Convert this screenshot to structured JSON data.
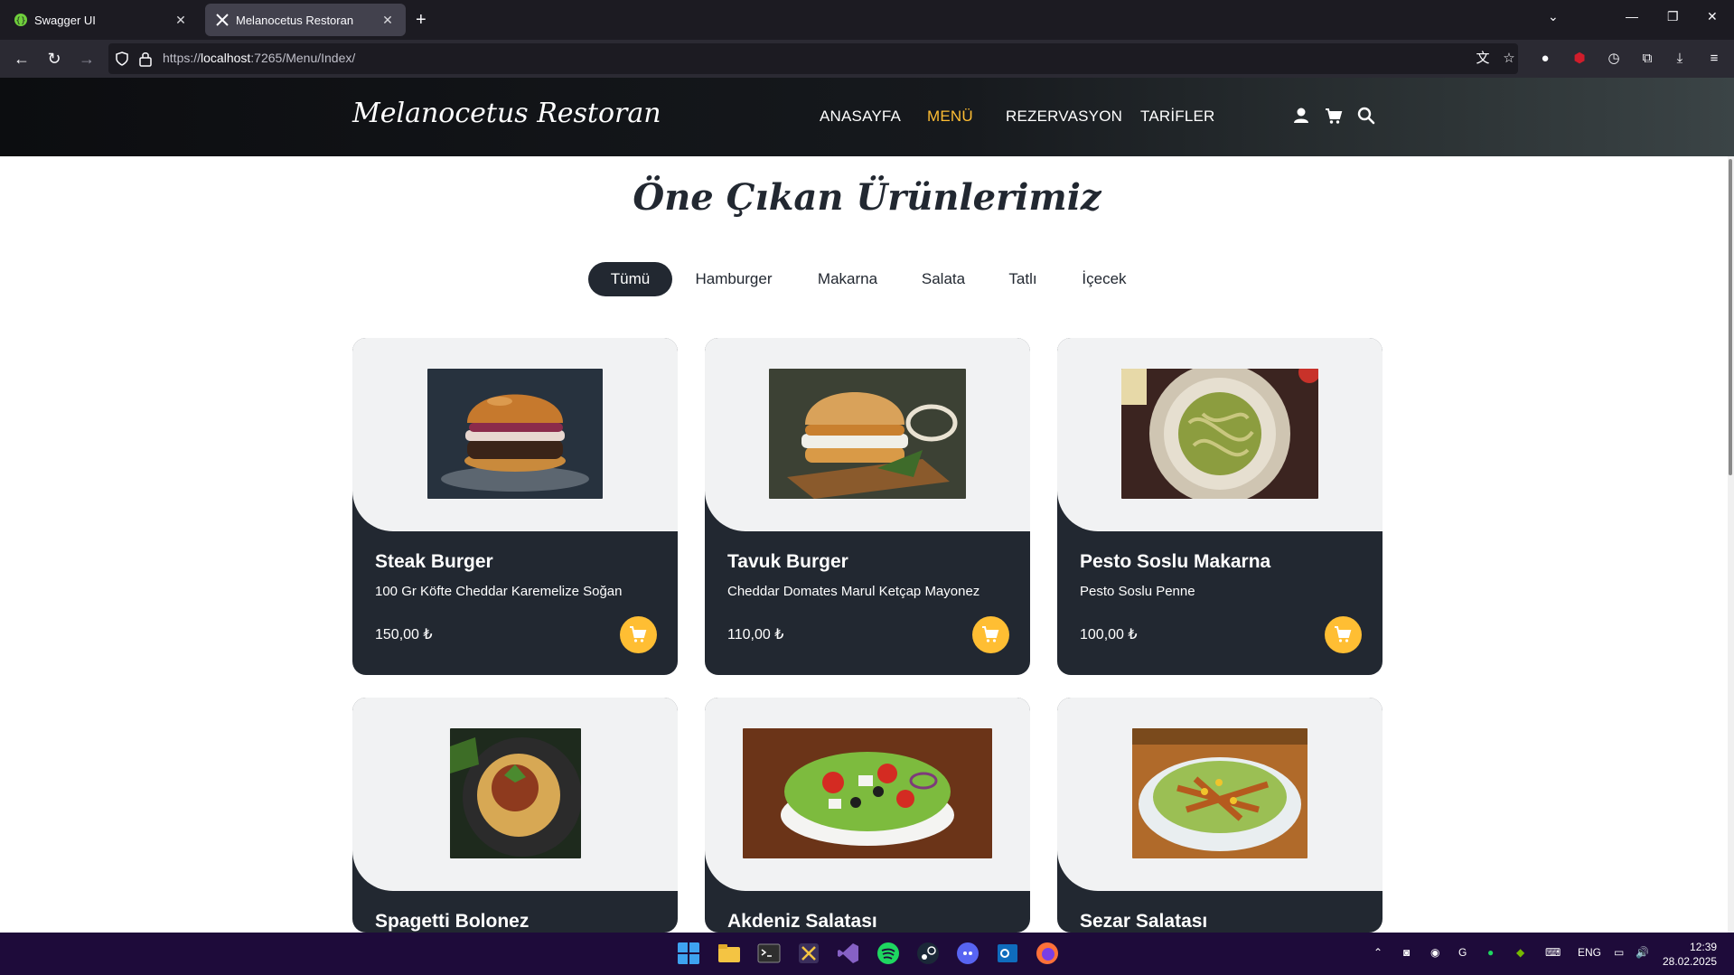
{
  "browser": {
    "tabs": [
      {
        "title": "Swagger UI",
        "favicon": "swagger-icon",
        "active": false
      },
      {
        "title": "Melanocetus Restoran",
        "favicon": "utensils-icon",
        "active": true
      }
    ],
    "url_prefix": "https://",
    "url_host": "localhost",
    "url_rest": ":7265/Menu/Index/"
  },
  "site": {
    "logo": "Melanocetus Restoran",
    "nav": [
      {
        "label": "ANASAYFA",
        "active": false
      },
      {
        "label": "MENÜ",
        "active": true
      },
      {
        "label": "REZERVASYON",
        "active": false
      },
      {
        "label": "TARİFLER",
        "active": false
      }
    ],
    "accent_color": "#ffbe33",
    "dark_color": "#222831"
  },
  "section": {
    "title": "Öne Çıkan Ürünlerimiz"
  },
  "filters": [
    "Tümü",
    "Hamburger",
    "Makarna",
    "Salata",
    "Tatlı",
    "İçecek"
  ],
  "products": [
    {
      "name": "Steak Burger",
      "description": "100 Gr Köfte Cheddar Karemelize Soğan",
      "price": "150,00 ₺"
    },
    {
      "name": "Tavuk Burger",
      "description": "Cheddar Domates Marul Ketçap Mayonez",
      "price": "110,00 ₺"
    },
    {
      "name": "Pesto Soslu Makarna",
      "description": "Pesto Soslu Penne",
      "price": "100,00 ₺"
    },
    {
      "name": "Spagetti Bolonez",
      "description": "",
      "price": ""
    },
    {
      "name": "Akdeniz Salatası",
      "description": "",
      "price": ""
    },
    {
      "name": "Sezar Salatası",
      "description": "",
      "price": ""
    }
  ],
  "taskbar": {
    "language": "ENG",
    "time": "12:39",
    "date": "28.02.2025"
  }
}
